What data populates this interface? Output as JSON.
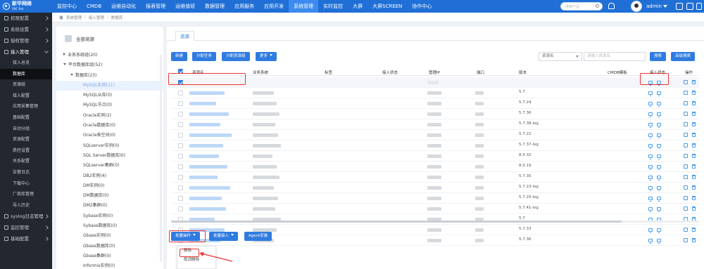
{
  "top_nav": {
    "brand": "新华网络",
    "brand_sub": "SNC Net",
    "items": [
      "监控中心",
      "CMDB",
      "运维自动化",
      "报表管理",
      "运维值班",
      "数据管理",
      "应用服务",
      "应用开发",
      "系统管理",
      "实时监控",
      "大屏",
      "大屏SCREEN",
      "协作中心"
    ],
    "active_index": 8,
    "search_placeholder": "搜索产品",
    "user": "admin"
  },
  "sidebar": {
    "sections": [
      {
        "label": "权限配置"
      },
      {
        "label": "系统设置"
      },
      {
        "label": "授权管理"
      },
      {
        "label": "接入管理",
        "open": true
      }
    ],
    "items": [
      "接入总览",
      "数据库",
      "资源组",
      "接入配置",
      "应用采集管理",
      "基础配置",
      "自动分组",
      "资源配置",
      "质控设置",
      "关系配置",
      "告警日志",
      "下载中心",
      "厂商库管理",
      "导入历史"
    ],
    "active_item": 1,
    "footer_sections": [
      "syslog日志管理",
      "监控管理",
      "基础配置"
    ]
  },
  "breadcrumb": [
    "系统管理",
    "接入管理",
    "数据库"
  ],
  "tree": {
    "title": "全部资源",
    "rows": [
      {
        "label": "业务系统组(20)",
        "level": 0,
        "caret": "right"
      },
      {
        "label": "平台数据库组(52)",
        "level": 0,
        "caret": "down"
      },
      {
        "label": "数据库(23)",
        "level": 1,
        "caret": "down"
      },
      {
        "label": "MySQL实例(11)",
        "level": 2,
        "selected": true
      },
      {
        "label": "MySQL从库(0)",
        "level": 2
      },
      {
        "label": "MySQL节点(0)",
        "level": 2
      },
      {
        "label": "Oracle实例(2)",
        "level": 2
      },
      {
        "label": "Oracle数据库(0)",
        "level": 2
      },
      {
        "label": "Oracle表空间(0)",
        "level": 2
      },
      {
        "label": "SQLserver实例(0)",
        "level": 2
      },
      {
        "label": "SQL Server数据库(0)",
        "level": 2
      },
      {
        "label": "SQLserver集群(0)",
        "level": 2
      },
      {
        "label": "DB2实例(4)",
        "level": 2
      },
      {
        "label": "DM实例(0)",
        "level": 2
      },
      {
        "label": "DM数据库(0)",
        "level": 2
      },
      {
        "label": "DM2集群(0)",
        "level": 2
      },
      {
        "label": "Sybase实例(0)",
        "level": 2
      },
      {
        "label": "Sybase数据库(0)",
        "level": 2
      },
      {
        "label": "Gbase实例(0)",
        "level": 2
      },
      {
        "label": "Gbase数据库(0)",
        "level": 2
      },
      {
        "label": "Gbase集群(0)",
        "level": 2
      },
      {
        "label": "Informix实例(0)",
        "level": 2
      }
    ]
  },
  "main": {
    "tab_label": "资源",
    "toolbar": {
      "new": "新建",
      "assign_task": "分配任务",
      "assign_group": "分配资源组",
      "more": "更多"
    },
    "filter": {
      "select_label": "资源名",
      "search_placeholder": "请输入资源名",
      "search_btn": "搜索",
      "advanced_btn": "高级搜索"
    },
    "columns": [
      "资源名",
      "业务系统",
      "标签",
      "接入状态",
      "管理IP",
      "端口",
      "版本",
      "CMDB模板",
      "接入状态",
      "操作"
    ],
    "rows": [
      {
        "version": ""
      },
      {
        "version": "5.7"
      },
      {
        "version": "5.7.24"
      },
      {
        "version": "5.7.36"
      },
      {
        "version": "5.7.38-log"
      },
      {
        "version": "5.7.22"
      },
      {
        "version": "5.7.37-log"
      },
      {
        "version": "8.0.32"
      },
      {
        "version": "8.0.19"
      },
      {
        "version": "5.7.35"
      },
      {
        "version": "5.7.23-log"
      },
      {
        "version": "5.7.25-log"
      },
      {
        "version": "5.7.41-log"
      },
      {
        "version": "5.7"
      },
      {
        "version": "5.7.33"
      },
      {
        "version": "5.7.36"
      }
    ],
    "bottom": {
      "batch_ops": "批量操作",
      "batch_access": "批量接入",
      "agent_install": "Agent安装"
    },
    "dropdown": [
      "删除",
      "取消删除"
    ]
  },
  "colors": {
    "topbar": "#1f6fd6",
    "sidebar": "#23272f",
    "accent": "#2f7be0",
    "highlight": "#e33333"
  }
}
